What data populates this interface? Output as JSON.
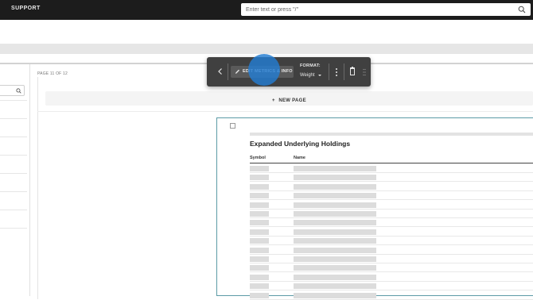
{
  "topbar": {
    "brand": "SUPPORT",
    "search_placeholder": "Enter text or press \"/\"",
    "search_icon": "search-icon"
  },
  "page": {
    "indicator": "PAGE 11 OF 12",
    "new_page_label": "NEW PAGE",
    "new_page_icon": "plus-icon"
  },
  "toolbar": {
    "back_icon": "chevron-left-icon",
    "edit_label": "EDIT METRICS & INFO",
    "edit_icon": "pencil-icon",
    "format_label": "FORMAT:",
    "format_value": "Weight",
    "more_icon": "more-vertical-icon",
    "delete_icon": "trash-icon",
    "drag_icon": "drag-handle-icon"
  },
  "widget": {
    "title": "Expanded Underlying Holdings",
    "columns": [
      "Symbol",
      "Name"
    ]
  },
  "colors": {
    "topbar_bg": "#1c1c1c",
    "toolbar_bg": "#404040",
    "highlight": "#237dd2",
    "widget_border": "#5c9ba6"
  }
}
